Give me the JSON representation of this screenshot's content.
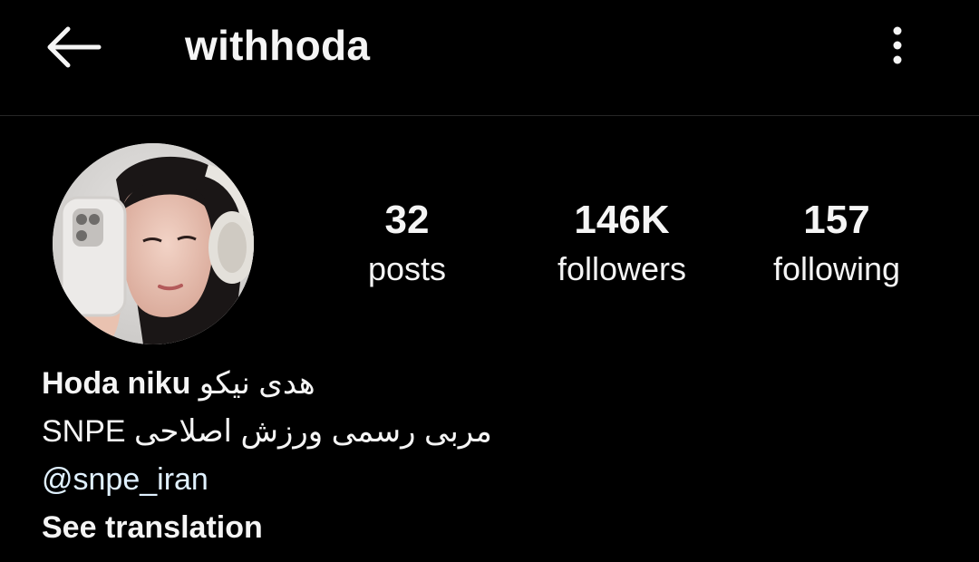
{
  "header": {
    "username": "withhoda",
    "back_icon": "arrow-left-icon",
    "more_icon": "more-vertical-icon"
  },
  "profile": {
    "avatar_alt": "profile-photo",
    "stats": [
      {
        "value": "32",
        "label": "posts"
      },
      {
        "value": "146K",
        "label": "followers"
      },
      {
        "value": "157",
        "label": "following"
      }
    ]
  },
  "bio": {
    "name_latin": "Hoda niku",
    "name_persian": "هدی نیکو",
    "line2": "SNPE مربی رسمی ورزش اصلاحی",
    "mention": "@snpe_iran",
    "see_translation": "See translation"
  },
  "colors": {
    "background": "#000000",
    "text": "#f5f5f5",
    "divider": "#262626",
    "mention": "#e0f1ff"
  }
}
